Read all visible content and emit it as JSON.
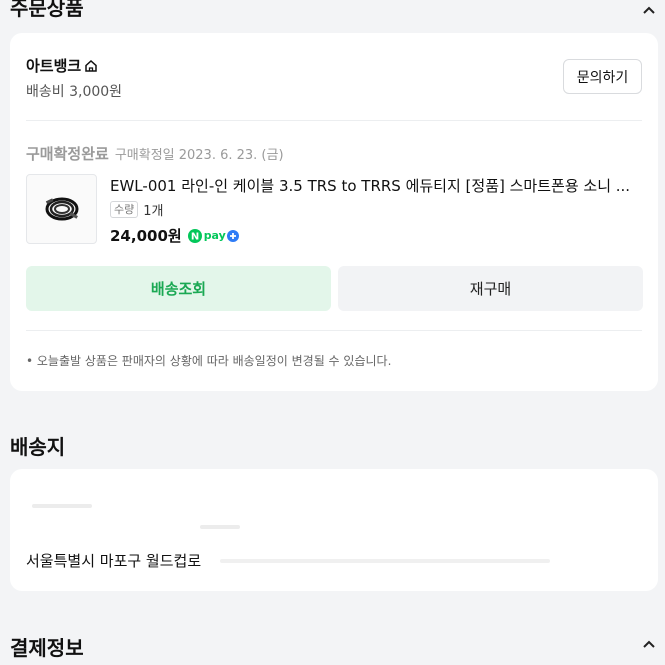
{
  "order_section": {
    "title": "주문상품"
  },
  "order_card": {
    "store_name": "아트뱅크",
    "shipping_fee": "배송비 3,000원",
    "inquiry_label": "문의하기",
    "status": "구매확정완료",
    "status_date": "구매확정일 2023. 6. 23. (금)",
    "product_name": "EWL-001 라인-인 케이블 3.5 TRS to TRRS 에듀티지 [정품] 스마트폰용 소니 ...",
    "qty_tag": "수량",
    "qty_value": "1개",
    "price": "24,000원",
    "npay_label": "pay",
    "track_button": "배송조회",
    "rebuy_button": "재구매",
    "notice": "• 오늘출발 상품은 판매자의 상황에 따라 배송일정이 변경될 수 있습니다."
  },
  "shipping_section": {
    "title": "배송지",
    "address": "서울특별시 마포구 월드컵로"
  },
  "payment_section": {
    "title": "결제정보"
  },
  "colors": {
    "accent_green": "#1aa853",
    "track_bg": "#e3f6ea",
    "npay_green": "#03c75a",
    "npay_plus": "#2e7cf6"
  },
  "icons": [
    "chevron-up-icon",
    "store-home-icon",
    "npay-logo-icon"
  ]
}
